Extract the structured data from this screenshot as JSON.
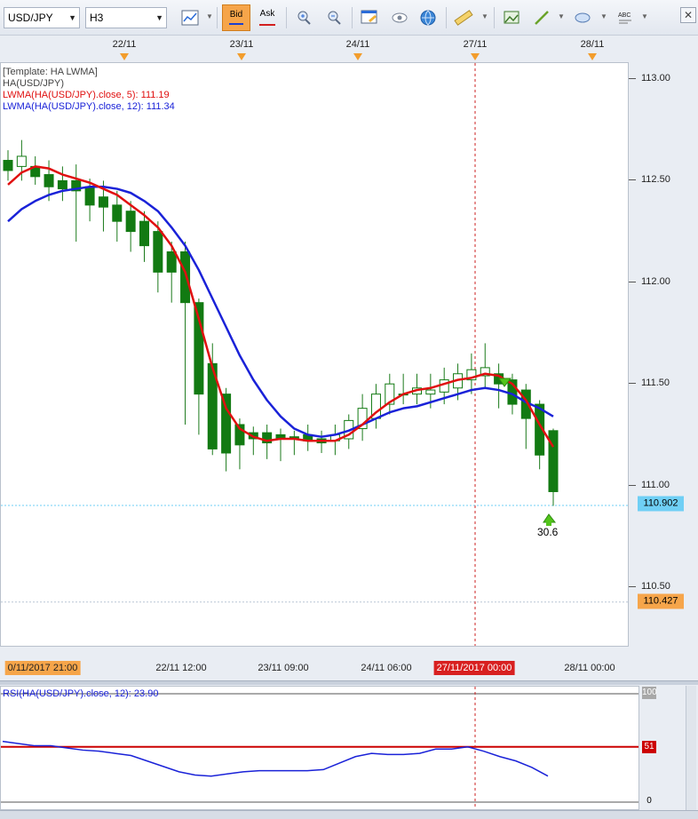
{
  "toolbar": {
    "symbol": "USD/JPY",
    "timeframe": "H3",
    "bid_label": "Bid",
    "ask_label": "Ask",
    "bid_underline_color": "#1a3fd0",
    "ask_underline_color": "#d21f1f",
    "text_tool_label": "ABC"
  },
  "top_axis": {
    "dates": [
      "22/11",
      "23/11",
      "24/11",
      "27/11",
      "28/11"
    ]
  },
  "legend": {
    "template": "[Template: HA LWMA]",
    "heikin_ashi": "HA(USD/JPY)",
    "lwma5": "LWMA(HA(USD/JPY).close, 5): 111.19",
    "lwma12": "LWMA(HA(USD/JPY).close, 12): 111.34",
    "lwma5_color": "#e01010",
    "lwma12_color": "#1a22d8"
  },
  "price_axis": {
    "labels": [
      "113.00",
      "112.50",
      "112.00",
      "111.50",
      "111.00",
      "110.50"
    ],
    "current_price": "110.902",
    "current_price_color": "#6fcff5",
    "low_marker": "110.427",
    "low_marker_color": "#f6a54a"
  },
  "annotation": {
    "value": "30.6",
    "arrow_color": "#52c41a"
  },
  "time_axis": {
    "labels": [
      "0/11/2017 21:00",
      "22/11 12:00",
      "23/11 09:00",
      "24/11 06:00",
      "27/11/2017 00:00",
      "28/11 00:00"
    ],
    "start_label_color": "#f6a54a",
    "highlight_color": "#d82020"
  },
  "rsi": {
    "label": "RSI(HA(USD/JPY).close, 12): 23.90",
    "axis_labels": [
      "100",
      "51",
      "0"
    ],
    "line_color": "#1a22d8",
    "level_color": "#cc0000"
  },
  "chart_data": {
    "type": "candlestick",
    "title": "",
    "instrument": "USD/JPY",
    "timeframe": "H3",
    "ylim": [
      110.25,
      113.1
    ],
    "ha_candles": [
      {
        "o": 112.6,
        "h": 112.65,
        "l": 112.5,
        "c": 112.55,
        "bull": false
      },
      {
        "o": 112.57,
        "h": 112.7,
        "l": 112.5,
        "c": 112.62,
        "bull": true
      },
      {
        "o": 112.57,
        "h": 112.62,
        "l": 112.48,
        "c": 112.52,
        "bull": false
      },
      {
        "o": 112.53,
        "h": 112.6,
        "l": 112.4,
        "c": 112.47,
        "bull": false
      },
      {
        "o": 112.5,
        "h": 112.57,
        "l": 112.4,
        "c": 112.46,
        "bull": false
      },
      {
        "o": 112.5,
        "h": 112.58,
        "l": 112.2,
        "c": 112.45,
        "bull": false
      },
      {
        "o": 112.47,
        "h": 112.51,
        "l": 112.3,
        "c": 112.38,
        "bull": false
      },
      {
        "o": 112.42,
        "h": 112.5,
        "l": 112.25,
        "c": 112.37,
        "bull": false
      },
      {
        "o": 112.38,
        "h": 112.45,
        "l": 112.2,
        "c": 112.3,
        "bull": false
      },
      {
        "o": 112.35,
        "h": 112.4,
        "l": 112.15,
        "c": 112.25,
        "bull": false
      },
      {
        "o": 112.3,
        "h": 112.35,
        "l": 112.1,
        "c": 112.18,
        "bull": false
      },
      {
        "o": 112.25,
        "h": 112.3,
        "l": 111.95,
        "c": 112.05,
        "bull": false
      },
      {
        "o": 112.15,
        "h": 112.2,
        "l": 111.9,
        "c": 112.05,
        "bull": false
      },
      {
        "o": 112.15,
        "h": 112.2,
        "l": 111.3,
        "c": 111.9,
        "bull": false
      },
      {
        "o": 111.9,
        "h": 111.92,
        "l": 111.25,
        "c": 111.45,
        "bull": false
      },
      {
        "o": 111.6,
        "h": 111.7,
        "l": 111.15,
        "c": 111.18,
        "bull": false
      },
      {
        "o": 111.45,
        "h": 111.48,
        "l": 111.07,
        "c": 111.16,
        "bull": false
      },
      {
        "o": 111.3,
        "h": 111.33,
        "l": 111.08,
        "c": 111.2,
        "bull": false
      },
      {
        "o": 111.26,
        "h": 111.29,
        "l": 111.15,
        "c": 111.23,
        "bull": false
      },
      {
        "o": 111.26,
        "h": 111.3,
        "l": 111.13,
        "c": 111.21,
        "bull": false
      },
      {
        "o": 111.25,
        "h": 111.28,
        "l": 111.12,
        "c": 111.23,
        "bull": false
      },
      {
        "o": 111.24,
        "h": 111.27,
        "l": 111.15,
        "c": 111.23,
        "bull": false
      },
      {
        "o": 111.25,
        "h": 111.3,
        "l": 111.17,
        "c": 111.22,
        "bull": false
      },
      {
        "o": 111.23,
        "h": 111.27,
        "l": 111.16,
        "c": 111.21,
        "bull": false
      },
      {
        "o": 111.22,
        "h": 111.3,
        "l": 111.15,
        "c": 111.25,
        "bull": true
      },
      {
        "o": 111.23,
        "h": 111.35,
        "l": 111.18,
        "c": 111.32,
        "bull": true
      },
      {
        "o": 111.28,
        "h": 111.45,
        "l": 111.22,
        "c": 111.38,
        "bull": true
      },
      {
        "o": 111.33,
        "h": 111.5,
        "l": 111.28,
        "c": 111.45,
        "bull": true
      },
      {
        "o": 111.4,
        "h": 111.55,
        "l": 111.35,
        "c": 111.5,
        "bull": true
      },
      {
        "o": 111.45,
        "h": 111.55,
        "l": 111.4,
        "c": 111.45,
        "bull": false
      },
      {
        "o": 111.45,
        "h": 111.55,
        "l": 111.4,
        "c": 111.48,
        "bull": true
      },
      {
        "o": 111.45,
        "h": 111.55,
        "l": 111.38,
        "c": 111.47,
        "bull": true
      },
      {
        "o": 111.46,
        "h": 111.58,
        "l": 111.4,
        "c": 111.52,
        "bull": true
      },
      {
        "o": 111.48,
        "h": 111.6,
        "l": 111.42,
        "c": 111.55,
        "bull": true
      },
      {
        "o": 111.52,
        "h": 111.65,
        "l": 111.45,
        "c": 111.57,
        "bull": true
      },
      {
        "o": 111.54,
        "h": 111.7,
        "l": 111.48,
        "c": 111.58,
        "bull": true
      },
      {
        "o": 111.55,
        "h": 111.6,
        "l": 111.38,
        "c": 111.5,
        "bull": false
      },
      {
        "o": 111.52,
        "h": 111.55,
        "l": 111.35,
        "c": 111.4,
        "bull": false
      },
      {
        "o": 111.47,
        "h": 111.5,
        "l": 111.18,
        "c": 111.33,
        "bull": false
      },
      {
        "o": 111.4,
        "h": 111.42,
        "l": 111.08,
        "c": 111.15,
        "bull": false
      },
      {
        "o": 111.27,
        "h": 111.28,
        "l": 110.9,
        "c": 110.97,
        "bull": false
      }
    ],
    "series": [
      {
        "name": "LWMA(HA(USD/JPY).close, 5)",
        "values": [
          112.48,
          112.54,
          112.57,
          112.56,
          112.53,
          112.51,
          112.49,
          112.46,
          112.43,
          112.38,
          112.33,
          112.27,
          112.18,
          112.05,
          111.82,
          111.58,
          111.38,
          111.28,
          111.24,
          111.22,
          111.23,
          111.23,
          111.22,
          111.22,
          111.22,
          111.25,
          111.3,
          111.36,
          111.41,
          111.45,
          111.47,
          111.48,
          111.5,
          111.52,
          111.53,
          111.55,
          111.54,
          111.5,
          111.42,
          111.3,
          111.19
        ]
      },
      {
        "name": "LWMA(HA(USD/JPY).close, 12)",
        "values": [
          112.3,
          112.36,
          112.4,
          112.43,
          112.45,
          112.46,
          112.47,
          112.47,
          112.46,
          112.44,
          112.4,
          112.35,
          112.27,
          112.18,
          112.06,
          111.92,
          111.78,
          111.64,
          111.52,
          111.42,
          111.34,
          111.28,
          111.25,
          111.24,
          111.25,
          111.27,
          111.3,
          111.33,
          111.36,
          111.38,
          111.39,
          111.41,
          111.43,
          111.45,
          111.47,
          111.48,
          111.47,
          111.45,
          111.41,
          111.38,
          111.34
        ]
      },
      {
        "name": "RSI(HA(USD/JPY).close, 12)",
        "values": [
          56,
          54,
          52,
          52,
          50,
          48,
          47,
          45,
          43,
          38,
          33,
          28,
          25,
          24,
          26,
          28,
          29,
          29,
          29,
          29,
          30,
          36,
          42,
          45,
          44,
          44,
          45,
          49,
          49,
          51,
          47,
          42,
          38,
          32,
          24
        ]
      }
    ],
    "rsi_ylim": [
      0,
      100
    ],
    "rsi_level": 51
  }
}
